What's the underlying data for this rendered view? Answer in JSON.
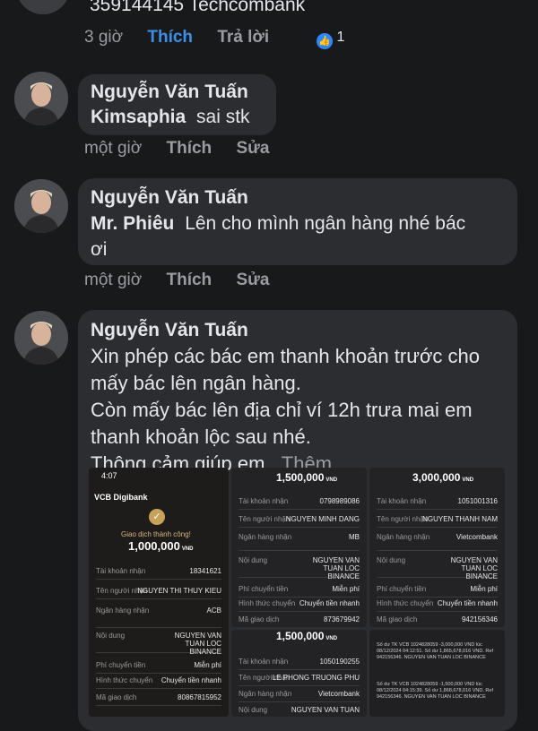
{
  "top_comment": {
    "text": "359144145 Techcombank",
    "time": "3 giờ",
    "like_label": "Thích",
    "reply_label": "Trả lời",
    "reaction_count": "1"
  },
  "comments": [
    {
      "author": "Nguyễn Văn Tuấn",
      "mention": "Kimsaphia",
      "text": "sai stk",
      "time": "một giờ",
      "like_label": "Thích",
      "edit_label": "Sửa"
    },
    {
      "author": "Nguyễn Văn Tuấn",
      "mention": "Mr. Phiêu",
      "text_line1": "Lên cho mình ngân hàng nhé bác",
      "text_line2": "ơi",
      "time": "một giờ",
      "like_label": "Thích",
      "edit_label": "Sửa"
    },
    {
      "author": "Nguyễn Văn Tuấn",
      "lines": [
        "Xin phép các bác em thanh khoản trước cho",
        "mấy bác lên ngân hàng.",
        "Còn mấy bác lên địa chỉ ví 12h trưa mai em",
        "thanh khoản lộc sau nhé.",
        "Thông cảm giúp em..."
      ],
      "see_more": "Thêm"
    }
  ],
  "screenshots": {
    "s1": {
      "status_time": "4:07",
      "app": "VCB Digibank",
      "success": "Giao dịch thành công!",
      "amount": "1,000,000",
      "currency": "VND",
      "rows": [
        {
          "k": "Tài khoản nhận",
          "v": "18341621"
        },
        {
          "k": "Tên người nhận",
          "v": "NGUYEN THI THUY KIEU"
        },
        {
          "k": "Ngân hàng nhận",
          "v": "ACB"
        },
        {
          "k": "Nội dung",
          "v": "NGUYEN VAN TUAN LOC BINANCE"
        },
        {
          "k": "Phí chuyển tiền",
          "v": "Miễn phí"
        },
        {
          "k": "Hình thức chuyển",
          "v": "Chuyển tiền nhanh"
        },
        {
          "k": "Mã giao dịch",
          "v": "80867815952"
        }
      ]
    },
    "s2": {
      "amount": "1,500,000",
      "currency": "VND",
      "rows": [
        {
          "k": "Tài khoản nhận",
          "v": "0798989086"
        },
        {
          "k": "Tên người nhận",
          "v": "NGUYEN MINH DANG"
        },
        {
          "k": "Ngân hàng nhận",
          "v": "MB"
        },
        {
          "k": "Nội dung",
          "v": "NGUYEN VAN TUAN LOC BINANCE"
        },
        {
          "k": "Phí chuyển tiền",
          "v": "Miễn phí"
        },
        {
          "k": "Hình thức chuyển",
          "v": "Chuyển tiền nhanh"
        },
        {
          "k": "Mã giao dịch",
          "v": "873679942"
        }
      ]
    },
    "s3": {
      "amount": "3,000,000",
      "currency": "VND",
      "rows": [
        {
          "k": "Tài khoản nhận",
          "v": "1051001316"
        },
        {
          "k": "Tên người nhận",
          "v": "NGUYEN THANH NAM"
        },
        {
          "k": "Ngân hàng nhận",
          "v": "Vietcombank"
        },
        {
          "k": "Nội dung",
          "v": "NGUYEN VAN TUAN LOC BINANCE"
        },
        {
          "k": "Phí chuyển tiền",
          "v": "Miễn phí"
        },
        {
          "k": "Hình thức chuyển",
          "v": "Chuyển tiền nhanh"
        },
        {
          "k": "Mã giao dịch",
          "v": "942156346"
        }
      ]
    },
    "s4": {
      "amount": "1,500,000",
      "currency": "VND",
      "rows": [
        {
          "k": "Tài khoản nhận",
          "v": "1050190255"
        },
        {
          "k": "Tên người nhận",
          "v": "LE PHONG TRUONG PHU"
        },
        {
          "k": "Ngân hàng nhận",
          "v": "Vietcombank"
        },
        {
          "k": "Nội dung",
          "v": "NGUYEN VAN TUAN"
        }
      ]
    },
    "s5": {
      "msg1": "Số dư TK VCB 1024828059 -3,000,000 VND lúc 08/12/2024 04:12:51. Số dư 1,865,678,016 VND. Ref 942156346. NGUYEN VAN TUAN LOC BINANCE",
      "msg2": "Số dư TK VCB 1024828059 -1,500,000 VND lúc 08/12/2024 04:15:39. Số dư 1,868,678,016 VND. Ref 942156346. NGUYEN VAN TUAN LOC BINANCE"
    }
  }
}
